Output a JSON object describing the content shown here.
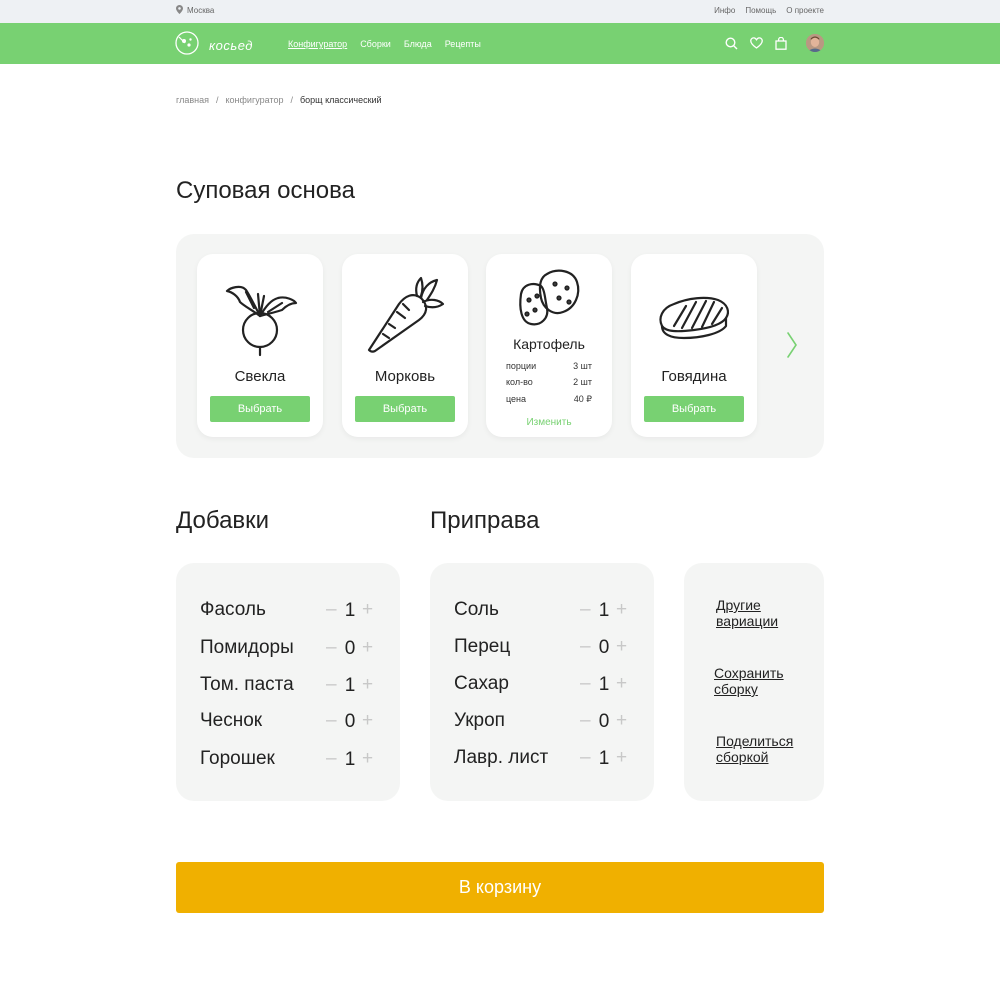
{
  "topbar": {
    "city": "Москва",
    "links": [
      "Инфо",
      "Помощь",
      "О проекте"
    ]
  },
  "nav": {
    "logo_text": "косьед",
    "items": [
      "Конфигуратор",
      "Сборки",
      "Блюда",
      "Рецепты"
    ],
    "active_item": "Конфигуратор",
    "icons": [
      "search-icon",
      "heart-icon",
      "bag-icon",
      "avatar"
    ]
  },
  "breadcrumb": [
    "главная",
    "конфигуратор",
    "борщ классический"
  ],
  "base_section": {
    "title": "Суповая основа",
    "cards": [
      {
        "name": "Свекла",
        "button": "Выбрать",
        "icon": "beet-icon"
      },
      {
        "name": "Морковь",
        "button": "Выбрать",
        "icon": "carrot-icon"
      },
      {
        "name": "Картофель",
        "icon": "potato-icon",
        "details": [
          {
            "label": "порции",
            "value": "3 шт"
          },
          {
            "label": "кол-во",
            "value": "2 шт"
          },
          {
            "label": "цена",
            "value": "40 ₽"
          }
        ],
        "link": "Изменить"
      },
      {
        "name": "Говядина",
        "button": "Выбрать",
        "icon": "beef-icon"
      }
    ]
  },
  "additions": {
    "title": "Добавки",
    "items": [
      {
        "name": "Фасоль",
        "qty": "1"
      },
      {
        "name": "Помидоры",
        "qty": "0"
      },
      {
        "name": "Том. паста",
        "qty": "1"
      },
      {
        "name": "Чеснок",
        "qty": "0"
      },
      {
        "name": "Горошек",
        "qty": "1"
      }
    ]
  },
  "seasoning": {
    "title": "Приправа",
    "items": [
      {
        "name": "Соль",
        "qty": "1"
      },
      {
        "name": "Перец",
        "qty": "0"
      },
      {
        "name": "Сахар",
        "qty": "1"
      },
      {
        "name": "Укроп",
        "qty": "0"
      },
      {
        "name": "Лавр. лист",
        "qty": "1"
      }
    ]
  },
  "qty_controls": {
    "minus": "–",
    "plus": "+"
  },
  "actions": {
    "other_line1": "Другие",
    "other_line2": "вариации",
    "save_line1": "Сохранить",
    "save_line2": "сборку",
    "share_line1": "Поделиться",
    "share_line2": "сборкой"
  },
  "cart_button": "В корзину",
  "colors": {
    "accent": "#78d172",
    "cart": "#f0b000",
    "panel": "#f4f5f4",
    "topbar": "#eef1f4"
  }
}
